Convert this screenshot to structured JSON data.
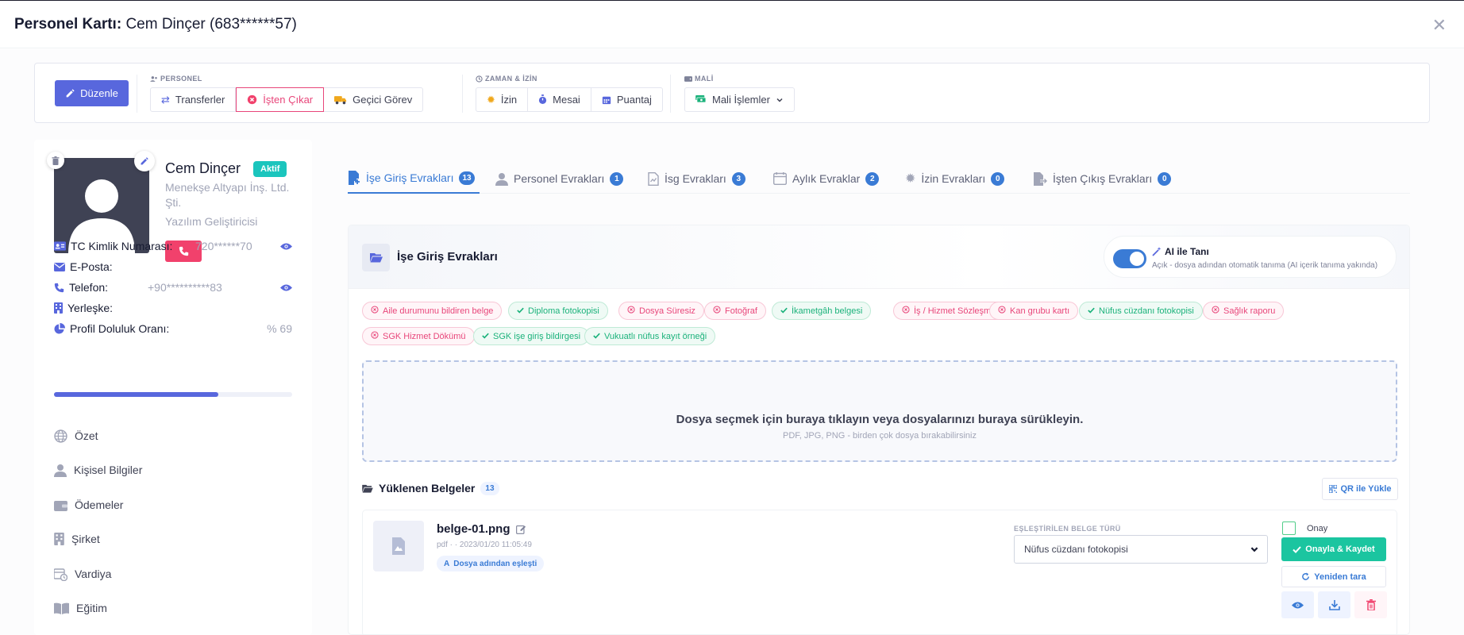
{
  "modal": {
    "title_label": "Personel Kartı:",
    "title_value": "Cem Dinçer (683******57)",
    "close_glyph": "✕"
  },
  "toolbar": {
    "edit_label": "Düzenle",
    "groups": {
      "personel": {
        "label": "PERSONEL",
        "buttons": {
          "transfers": "Transferler",
          "dismiss": "İşten Çıkar",
          "temp_duty": "Geçici Görev"
        }
      },
      "zaman": {
        "label": "ZAMAN & İZİN",
        "buttons": {
          "leave": "İzin",
          "overtime": "Mesai",
          "timesheet": "Puantaj"
        }
      },
      "mali": {
        "label": "MALİ",
        "buttons": {
          "financial": "Mali İşlemler"
        }
      }
    }
  },
  "profile": {
    "name": "Cem Dinçer",
    "status": "Aktif",
    "company": "Menekşe Altyapı İnş. Ltd. Şti.",
    "job_title": "Yazılım Geliştiricisi",
    "info": {
      "tc_label": "TC Kimlik Numarası:",
      "tc_value": "720******70",
      "email_label": "E-Posta:",
      "phone_label": "Telefon:",
      "phone_value": "+90**********83",
      "campus_label": "Yerleşke:",
      "completion_label": "Profil Doluluk Oranı:",
      "completion_value": "% 69",
      "completion_fraction": 0.69
    },
    "nav": {
      "summary": "Özet",
      "personal": "Kişisel Bilgiler",
      "payments": "Ödemeler",
      "company": "Şirket",
      "shift": "Vardiya",
      "education": "Eğitim"
    }
  },
  "tabs": [
    {
      "label": "İşe Giriş Evrakları",
      "count": "13"
    },
    {
      "label": "Personel Evrakları",
      "count": "1"
    },
    {
      "label": "İsg Evrakları",
      "count": "3"
    },
    {
      "label": "Aylık Evraklar",
      "count": "2"
    },
    {
      "label": "İzin Evrakları",
      "count": "0"
    },
    {
      "label": "İşten Çıkış Evrakları",
      "count": "0"
    }
  ],
  "panel": {
    "title": "İşe Giriş Evrakları",
    "ai": {
      "title": "AI ile Tanı",
      "subtitle": "Açık - dosya adından otomatik tanıma (AI içerik tanıma yakında)"
    },
    "chips": [
      {
        "label": "Aile durumunu bildiren belge",
        "status": "missing"
      },
      {
        "label": "Diploma fotokopisi",
        "status": "ok"
      },
      {
        "label": "Dosya Süresiz",
        "status": "missing"
      },
      {
        "label": "Fotoğraf",
        "status": "missing"
      },
      {
        "label": "İkametgâh belgesi",
        "status": "ok"
      },
      {
        "label": "İş / Hizmet Sözleşmesi",
        "status": "missing"
      },
      {
        "label": "Kan grubu kartı",
        "status": "missing"
      },
      {
        "label": "Nüfus cüzdanı fotokopisi",
        "status": "ok"
      },
      {
        "label": "Sağlık raporu",
        "status": "missing"
      },
      {
        "label": "SGK Hizmet Dökümü",
        "status": "missing"
      },
      {
        "label": "SGK işe giriş bildirgesi",
        "status": "ok"
      },
      {
        "label": "Vukuatlı nüfus kayıt örneği",
        "status": "ok"
      }
    ],
    "dropzone": {
      "title": "Dosya seçmek için buraya tıklayın veya dosyalarınızı buraya sürükleyin.",
      "subtitle": "PDF, JPG, PNG - birden çok dosya bırakabilirsiniz"
    },
    "uploaded": {
      "title": "Yüklenen Belgeler",
      "count": "13",
      "qr_label": "QR ile Yükle"
    },
    "document": {
      "name": "belge-01.png",
      "meta": "pdf · · 2023/01/20 11:05:49",
      "tag": "Dosya adından eşleşti",
      "match_label": "EŞLEŞTİRİLEN BELGE TÜRÜ",
      "match_value": "Nüfus cüzdanı fotokopisi",
      "approve_check_label": "Onay",
      "approve_save_label": "Onayla & Kaydet",
      "rescan_label": "Yeniden tara"
    }
  },
  "colors": {
    "primary": "#5867dd",
    "accent_blue": "#3a7bd5",
    "danger": "#f1416c",
    "success": "#1bc5a0",
    "status_active": "#1bc5bd"
  }
}
